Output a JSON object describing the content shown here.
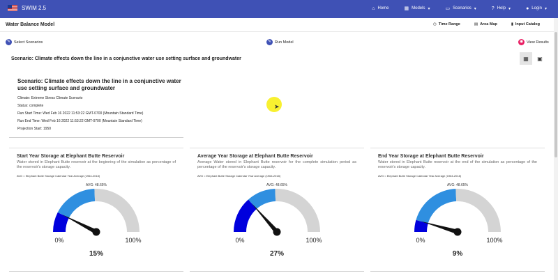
{
  "app": {
    "name": "SWIM 2.5"
  },
  "nav": {
    "home": "Home",
    "models": "Models",
    "scenarios": "Scenarios",
    "help": "Help",
    "login": "Login"
  },
  "subbar": {
    "title": "Water Balance Model",
    "time_range": "Time Range",
    "area_map": "Area Map",
    "input_catalog": "Input Catalog"
  },
  "stepper": {
    "select_scenarios": "Select Scenarios",
    "run_model": "Run Model",
    "view_results": "View Results"
  },
  "scenario": {
    "header": "Scenario: Climate effects down the line in a conjunctive water use setting surface and groundwater",
    "title": "Scenario: Climate effects down the line in a conjunctive water use setting surface and groundwater",
    "climate": "Climate: Extreme Stress Climate Scenario",
    "status": "Status: complete",
    "run_start": "Run Start Time: Wed Feb 16 2022 11:53:22 GMT-0700 (Mountain Standard Time)",
    "run_end": "Run End Time: Wed Feb 16 2022 11:53:22 GMT-0700 (Mountain Standard Time)",
    "projection_start": "Projection Start: 1950"
  },
  "colors": {
    "navbar": "#3f51b5",
    "step_blue": "#3f51b5",
    "step_pink": "#e91e63",
    "gauge_dark": "#0000dd",
    "gauge_mid": "#2f8fe0",
    "gauge_rest": "#d4d4d4"
  },
  "gauges": [
    {
      "title": "Start Year Storage at Elephant Butte Reservoir",
      "description": "Water stored in Elephant Butte reservoir at the beginning of the simulation as percentage of the reservoir's storage capacity.",
      "legend": "AVG = Elephant Butte Storage Calendar Year Average (1964-2018)",
      "avg_label": "AVG: 48.65%",
      "min_label": "0%",
      "max_label": "100%",
      "value_label": "15%",
      "value": 15,
      "avg": 48.65
    },
    {
      "title": "Average Year Storage at Elephant Butte Reservoir",
      "description": "Average Water stored in Elephant Butte reservoir for the complete simulation period as percentage of the reservoir's storage capacity.",
      "legend": "AVG = Elephant Butte Storage Calendar Year Average (1964-2018)",
      "avg_label": "AVG: 48.65%",
      "min_label": "0%",
      "max_label": "100%",
      "value_label": "27%",
      "value": 27,
      "avg": 48.65
    },
    {
      "title": "End Year Storage at Elephant Butte Reservoir",
      "description": "Water stored in Elephant Butte reservoir at the end of the simulation as percentage of the reservoir's storage capacity.",
      "legend": "AVG = Elephant Butte Storage Calendar Year Average (1964-2018)",
      "avg_label": "AVG: 48.65%",
      "min_label": "0%",
      "max_label": "100%",
      "value_label": "9%",
      "value": 9,
      "avg": 48.65
    }
  ]
}
